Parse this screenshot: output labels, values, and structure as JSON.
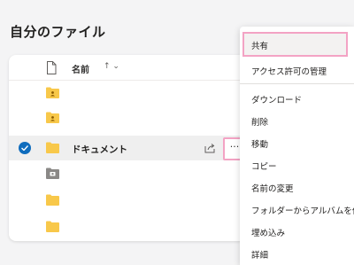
{
  "page": {
    "title": "自分のファイル"
  },
  "table": {
    "header": {
      "name_label": "名前",
      "sort_indicator": "↑ ⌄"
    },
    "rows": [
      {
        "name": "",
        "icon": "shared-folder-icon",
        "selected": false
      },
      {
        "name": "",
        "icon": "shared-folder-icon",
        "selected": false
      },
      {
        "name": "ドキュメント",
        "icon": "folder-icon",
        "selected": true
      },
      {
        "name": "",
        "icon": "camera-roll-folder-icon",
        "selected": false
      },
      {
        "name": "",
        "icon": "folder-icon",
        "selected": false
      },
      {
        "name": "",
        "icon": "folder-icon",
        "selected": false
      }
    ],
    "more_button_label": "···"
  },
  "menu": {
    "items": [
      {
        "label": "共有"
      },
      {
        "label": "アクセス許可の管理"
      },
      {
        "label": "ダウンロード"
      },
      {
        "label": "削除"
      },
      {
        "label": "移動"
      },
      {
        "label": "コピー"
      },
      {
        "label": "名前の変更"
      },
      {
        "label": "フォルダーからアルバムを作成"
      },
      {
        "label": "埋め込み"
      },
      {
        "label": "詳細"
      }
    ]
  },
  "colors": {
    "accent": "#0f6cbd",
    "folder": "#f8c84a",
    "highlight_border": "#f3a3c4"
  }
}
